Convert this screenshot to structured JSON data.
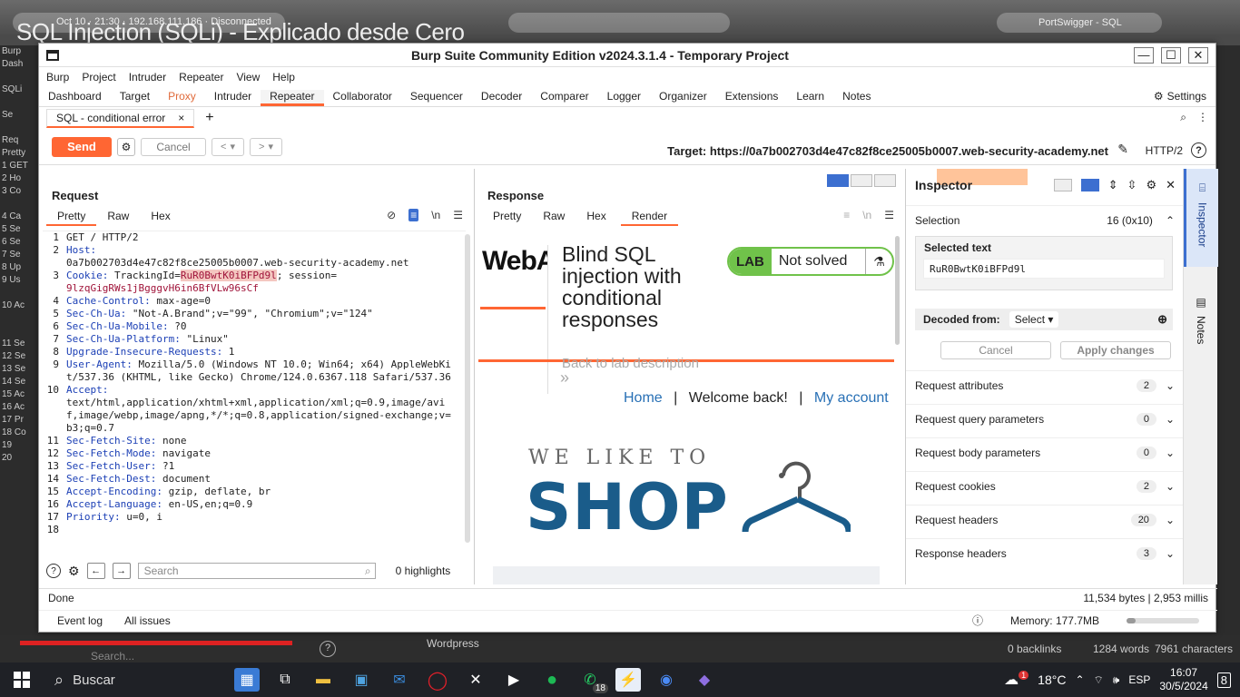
{
  "video": {
    "title": "SQL Injection (SQLi) - Explicado desde Cero",
    "meta": "Oct 10 · 21:30   ·   192.168.111.186   ·   Disconnected",
    "tab": "PortSwigger - SQL"
  },
  "bg_left_lines": [
    "Burp",
    "Dash",
    "",
    "SQLi",
    "",
    "Se",
    "",
    "Req",
    "Pretty",
    "1 GET",
    "2 Ho",
    "3 Co",
    "",
    "4 Ca",
    "5 Se",
    "6 Se",
    "7 Se",
    "8 Up",
    "9 Us",
    "",
    "10 Ac",
    "",
    "",
    "11 Se",
    "12 Se",
    "13 Se",
    "14 Se",
    "15 Ac",
    "16 Ac",
    "17 Pr",
    "18 Co",
    "19",
    "20"
  ],
  "window": {
    "title": "Burp Suite Community Edition v2024.3.1.4 - Temporary Project",
    "min": "—",
    "max": "☐",
    "close": "✕"
  },
  "menu": [
    "Burp",
    "Project",
    "Intruder",
    "Repeater",
    "View",
    "Help"
  ],
  "tabs": [
    "Dashboard",
    "Target",
    "Proxy",
    "Intruder",
    "Repeater",
    "Collaborator",
    "Sequencer",
    "Decoder",
    "Comparer",
    "Logger",
    "Organizer",
    "Extensions",
    "Learn",
    "Notes"
  ],
  "settings_label": "Settings",
  "subtab": {
    "label": "SQL - conditional error",
    "close": "×",
    "add": "+"
  },
  "toolbar": {
    "send": "Send",
    "cancel": "Cancel",
    "prev": "<",
    "next": ">",
    "target": "Target: https://0a7b002703d4e47c82f8ce25005b0007.web-security-academy.net",
    "protocol": "HTTP/2",
    "help": "?"
  },
  "request": {
    "title": "Request",
    "tabs": [
      "Pretty",
      "Raw",
      "Hex"
    ],
    "tool_newline": "\\n",
    "lines": [
      {
        "n": "1",
        "k": "",
        "v": "GET / HTTP/2"
      },
      {
        "n": "2",
        "k": "Host:",
        "v": "\n0a7b002703d4e47c82f8ce25005b0007.web-security-academy.net"
      },
      {
        "n": "3",
        "k": "Cookie:",
        "v": " TrackingId=",
        "sel": "RuR0BwtK0iBFPd9l",
        "rest": "; session=",
        "cv": "9lzqGigRWs1jBgggvH6in6BfVLw96sCf"
      },
      {
        "n": "4",
        "k": "Cache-Control:",
        "v": " max-age=0"
      },
      {
        "n": "5",
        "k": "Sec-Ch-Ua:",
        "v": " \"Not-A.Brand\";v=\"99\", \"Chromium\";v=\"124\""
      },
      {
        "n": "6",
        "k": "Sec-Ch-Ua-Mobile:",
        "v": " ?0"
      },
      {
        "n": "7",
        "k": "Sec-Ch-Ua-Platform:",
        "v": " \"Linux\""
      },
      {
        "n": "8",
        "k": "Upgrade-Insecure-Requests:",
        "v": " 1"
      },
      {
        "n": "9",
        "k": "User-Agent:",
        "v": " Mozilla/5.0 (Windows NT 10.0; Win64; x64) AppleWebKit/537.36 (KHTML, like Gecko) Chrome/124.0.6367.118 Safari/537.36"
      },
      {
        "n": "10",
        "k": "Accept:",
        "v": "\ntext/html,application/xhtml+xml,application/xml;q=0.9,image/avif,image/webp,image/apng,*/*;q=0.8,application/signed-exchange;v=b3;q=0.7"
      },
      {
        "n": "11",
        "k": "Sec-Fetch-Site:",
        "v": " none"
      },
      {
        "n": "12",
        "k": "Sec-Fetch-Mode:",
        "v": " navigate"
      },
      {
        "n": "13",
        "k": "Sec-Fetch-User:",
        "v": " ?1"
      },
      {
        "n": "14",
        "k": "Sec-Fetch-Dest:",
        "v": " document"
      },
      {
        "n": "15",
        "k": "Accept-Encoding:",
        "v": " gzip, deflate, br"
      },
      {
        "n": "16",
        "k": "Accept-Language:",
        "v": " en-US,en;q=0.9"
      },
      {
        "n": "17",
        "k": "Priority:",
        "v": " u=0, i"
      },
      {
        "n": "18",
        "k": "",
        "v": ""
      }
    ],
    "search_placeholder": "Search",
    "highlights": "0 highlights"
  },
  "response": {
    "title": "Response",
    "tabs": [
      "Pretty",
      "Raw",
      "Hex",
      "Render"
    ],
    "page": {
      "logo": "WebAcad",
      "heading": "Blind SQL injection with conditional responses",
      "lab_badge": "LAB",
      "lab_status": "Not solved",
      "back_link": "Back to lab description",
      "chevrons": "»",
      "nav_home": "Home",
      "nav_sep": "|",
      "nav_welcome": "Welcome back!",
      "nav_account": "My account",
      "shop_top": "WE LIKE TO",
      "shop_main": "SHOP"
    }
  },
  "inspector": {
    "title": "Inspector",
    "selection_label": "Selection",
    "selection_value": "16 (0x10)",
    "selected_text_label": "Selected text",
    "selected_text": "RuR0BwtK0iBFPd9l",
    "decoded_label": "Decoded from:",
    "decoded_select": "Select",
    "cancel": "Cancel",
    "apply": "Apply changes",
    "sections": [
      {
        "label": "Request attributes",
        "count": "2"
      },
      {
        "label": "Request query parameters",
        "count": "0"
      },
      {
        "label": "Request body parameters",
        "count": "0"
      },
      {
        "label": "Request cookies",
        "count": "2"
      },
      {
        "label": "Request headers",
        "count": "20"
      },
      {
        "label": "Response headers",
        "count": "3"
      }
    ]
  },
  "right_sidebar": [
    "Inspector",
    "Notes"
  ],
  "status": {
    "left": "Done",
    "right": "11,534 bytes | 2,953 millis"
  },
  "bottom": {
    "event_log": "Event log",
    "all_issues": "All issues",
    "memory": "Memory: 177.7MB",
    "memory_fraction": 0.12
  },
  "under_window": {
    "wordpress": "Wordpress",
    "backlinks": "0 backlinks",
    "words": "1284 words",
    "characters": "7961 characters",
    "search": "Search..."
  },
  "taskbar": {
    "search": "Buscar",
    "badge_whatsapp": "18",
    "weather": "18°C",
    "weather_badge": "1",
    "lang": "ESP",
    "time": "16:07",
    "date": "30/5/2024",
    "notif": "8"
  }
}
